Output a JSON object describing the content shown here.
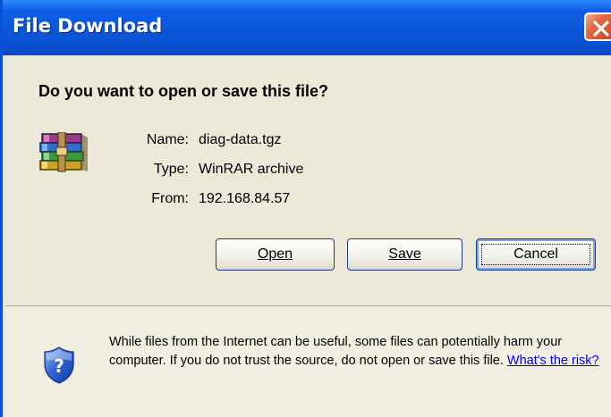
{
  "window": {
    "title": "File Download"
  },
  "dialog": {
    "question": "Do you want to open or save this file?",
    "file": {
      "name_label": "Name:",
      "name_value": "diag-data.tgz",
      "type_label": "Type:",
      "type_value": "WinRAR archive",
      "from_label": "From:",
      "from_value": "192.168.84.57",
      "icon": "winrar-archive-icon"
    },
    "buttons": {
      "open_label": "Open",
      "save_label": "Save",
      "cancel_label": "Cancel"
    },
    "warning": {
      "text": "While files from the Internet can be useful, some files can potentially harm your computer. If you do not trust the source, do not open or save this file. ",
      "link_text": "What's the risk?",
      "icon": "shield-question-icon"
    }
  },
  "colors": {
    "titlebar": "#0a56d8",
    "close_button": "#d4461f",
    "dialog_face": "#ece9d8",
    "link": "#0000ff"
  }
}
